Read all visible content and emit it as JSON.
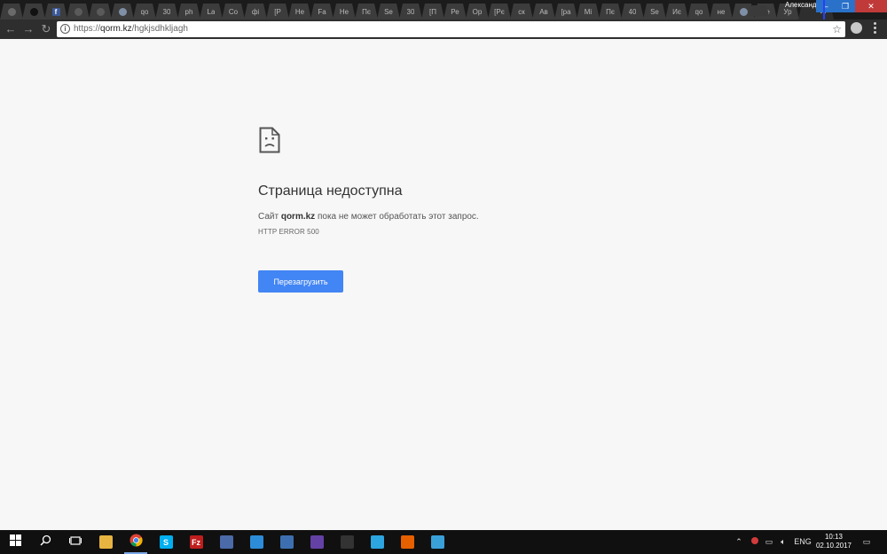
{
  "window": {
    "profile_name": "Александр",
    "controls": {
      "minimize": "–",
      "maximize": "❐",
      "close": "✕"
    }
  },
  "tabs": [
    {
      "label": "",
      "icon": "back-tab-icon",
      "color": "#6a6a6a"
    },
    {
      "label": "",
      "icon": "dark-circle-icon",
      "color": "#111111"
    },
    {
      "label": "f",
      "icon": "facebook-icon",
      "color": "#3b5998"
    },
    {
      "label": "",
      "icon": "doc-icon",
      "color": "#5a5a5a"
    },
    {
      "label": "",
      "icon": "doc-icon",
      "color": "#5a5a5a"
    },
    {
      "label": "",
      "icon": "globe-icon",
      "color": "#7f8fa6"
    },
    {
      "label": "qo",
      "icon": "page-icon"
    },
    {
      "label": "30",
      "icon": "page-icon"
    },
    {
      "label": "ph",
      "icon": "page-icon"
    },
    {
      "label": "La",
      "icon": "page-icon"
    },
    {
      "label": "Co",
      "icon": "page-icon"
    },
    {
      "label": "фі",
      "icon": "page-icon"
    },
    {
      "label": "[Р",
      "icon": "page-icon"
    },
    {
      "label": "Не",
      "icon": "page-icon"
    },
    {
      "label": "Fa",
      "icon": "page-icon"
    },
    {
      "label": "Не",
      "icon": "page-icon"
    },
    {
      "label": "Пє",
      "icon": "page-icon"
    },
    {
      "label": "Se",
      "icon": "page-icon"
    },
    {
      "label": "30",
      "icon": "page-icon"
    },
    {
      "label": "[П",
      "icon": "page-icon"
    },
    {
      "label": "Ре",
      "icon": "page-icon"
    },
    {
      "label": "Ор",
      "icon": "page-icon"
    },
    {
      "label": "[Рє",
      "icon": "page-icon"
    },
    {
      "label": "ск",
      "icon": "page-icon"
    },
    {
      "label": "Ав",
      "icon": "page-icon"
    },
    {
      "label": "[ра",
      "icon": "page-icon"
    },
    {
      "label": "Mi",
      "icon": "page-icon"
    },
    {
      "label": "Пє",
      "icon": "page-icon"
    },
    {
      "label": "40",
      "icon": "page-icon"
    },
    {
      "label": "Se",
      "icon": "page-icon"
    },
    {
      "label": "Иє",
      "icon": "page-icon"
    },
    {
      "label": "qo",
      "icon": "page-icon"
    },
    {
      "label": "не",
      "icon": "page-icon"
    },
    {
      "label": "",
      "icon": "globe-icon",
      "color": "#7f8fa6"
    },
    {
      "label": "Ве",
      "icon": "page-icon"
    },
    {
      "label": "Ур",
      "icon": "page-icon"
    }
  ],
  "active_tab": {
    "close": "✕"
  },
  "toolbar": {
    "back": "←",
    "forward": "→",
    "reload": "↻",
    "url_scheme": "https://",
    "url_host": "qorm.kz",
    "url_path": "/hgkjsdhkljagh",
    "star": "☆"
  },
  "error_page": {
    "title": "Страница недоступна",
    "desc_prefix": "Сайт ",
    "desc_host": "qorm.kz",
    "desc_suffix": " пока не может обработать этот запрос.",
    "code": "HTTP ERROR 500",
    "reload_label": "Перезагрузить",
    "accent_color": "#4285f4"
  },
  "taskbar": {
    "apps": [
      {
        "name": "start-button",
        "icon": "windows-icon"
      },
      {
        "name": "search-button",
        "icon": "search-icon"
      },
      {
        "name": "task-view-button",
        "icon": "task-view-icon"
      },
      {
        "name": "explorer-app",
        "icon": "folder-icon",
        "color": "#e7b441"
      },
      {
        "name": "chrome-app",
        "icon": "chrome-icon",
        "color": "#4a9a4a",
        "active": true
      },
      {
        "name": "skype-app",
        "icon": "skype-icon",
        "color": "#00aff0",
        "glyph": "S"
      },
      {
        "name": "filezilla-app",
        "icon": "filezilla-icon",
        "color": "#bf1e1e",
        "glyph": "Fz"
      },
      {
        "name": "network-app",
        "icon": "network-icon",
        "color": "#4b6aa8"
      },
      {
        "name": "teamviewer-app",
        "icon": "teamviewer-icon",
        "color": "#2d8cd8"
      },
      {
        "name": "thunderbird-app",
        "icon": "thunderbird-icon",
        "color": "#3d6fb0"
      },
      {
        "name": "twitch-app",
        "icon": "twitch-icon",
        "color": "#6441a5"
      },
      {
        "name": "terminal-app",
        "icon": "terminal-icon",
        "color": "#333333"
      },
      {
        "name": "telegram-app",
        "icon": "telegram-icon",
        "color": "#2ca5e0"
      },
      {
        "name": "firefox-app",
        "icon": "firefox-icon",
        "color": "#e66000"
      },
      {
        "name": "remote-app",
        "icon": "remote-desktop-icon",
        "color": "#3aa0d8"
      }
    ],
    "tray": {
      "chevron": "⌃",
      "language": "ENG",
      "time": "10:13",
      "date": "02.10.2017"
    }
  }
}
